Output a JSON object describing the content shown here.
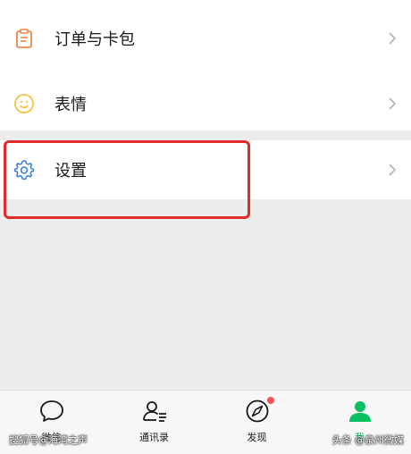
{
  "menu": {
    "orders_label": "订单与卡包",
    "emoji_label": "表情",
    "settings_label": "设置"
  },
  "icons": {
    "orders": "order-card-icon",
    "emoji": "smiley-icon",
    "settings": "gear-icon",
    "chevron": "chevron-right-icon"
  },
  "tabbar": {
    "tabs": [
      {
        "label": "微信",
        "icon": "chat-bubble-icon"
      },
      {
        "label": "通讯录",
        "icon": "contacts-icon"
      },
      {
        "label": "发现",
        "icon": "compass-icon",
        "badge": "red-dot"
      },
      {
        "label": "我",
        "icon": "me-person-icon",
        "active": true
      }
    ]
  },
  "watermarks": {
    "left": "搜狐号@海湾之声",
    "right": "头条 @泉州微媒"
  },
  "colors": {
    "accent_green": "#07c160",
    "highlight_red": "#e02b2b",
    "badge_red": "#fa5151",
    "order_icon_orange": "#f0854a",
    "emoji_icon_yellow": "#f5c542",
    "settings_icon_blue": "#3b7fd8"
  }
}
